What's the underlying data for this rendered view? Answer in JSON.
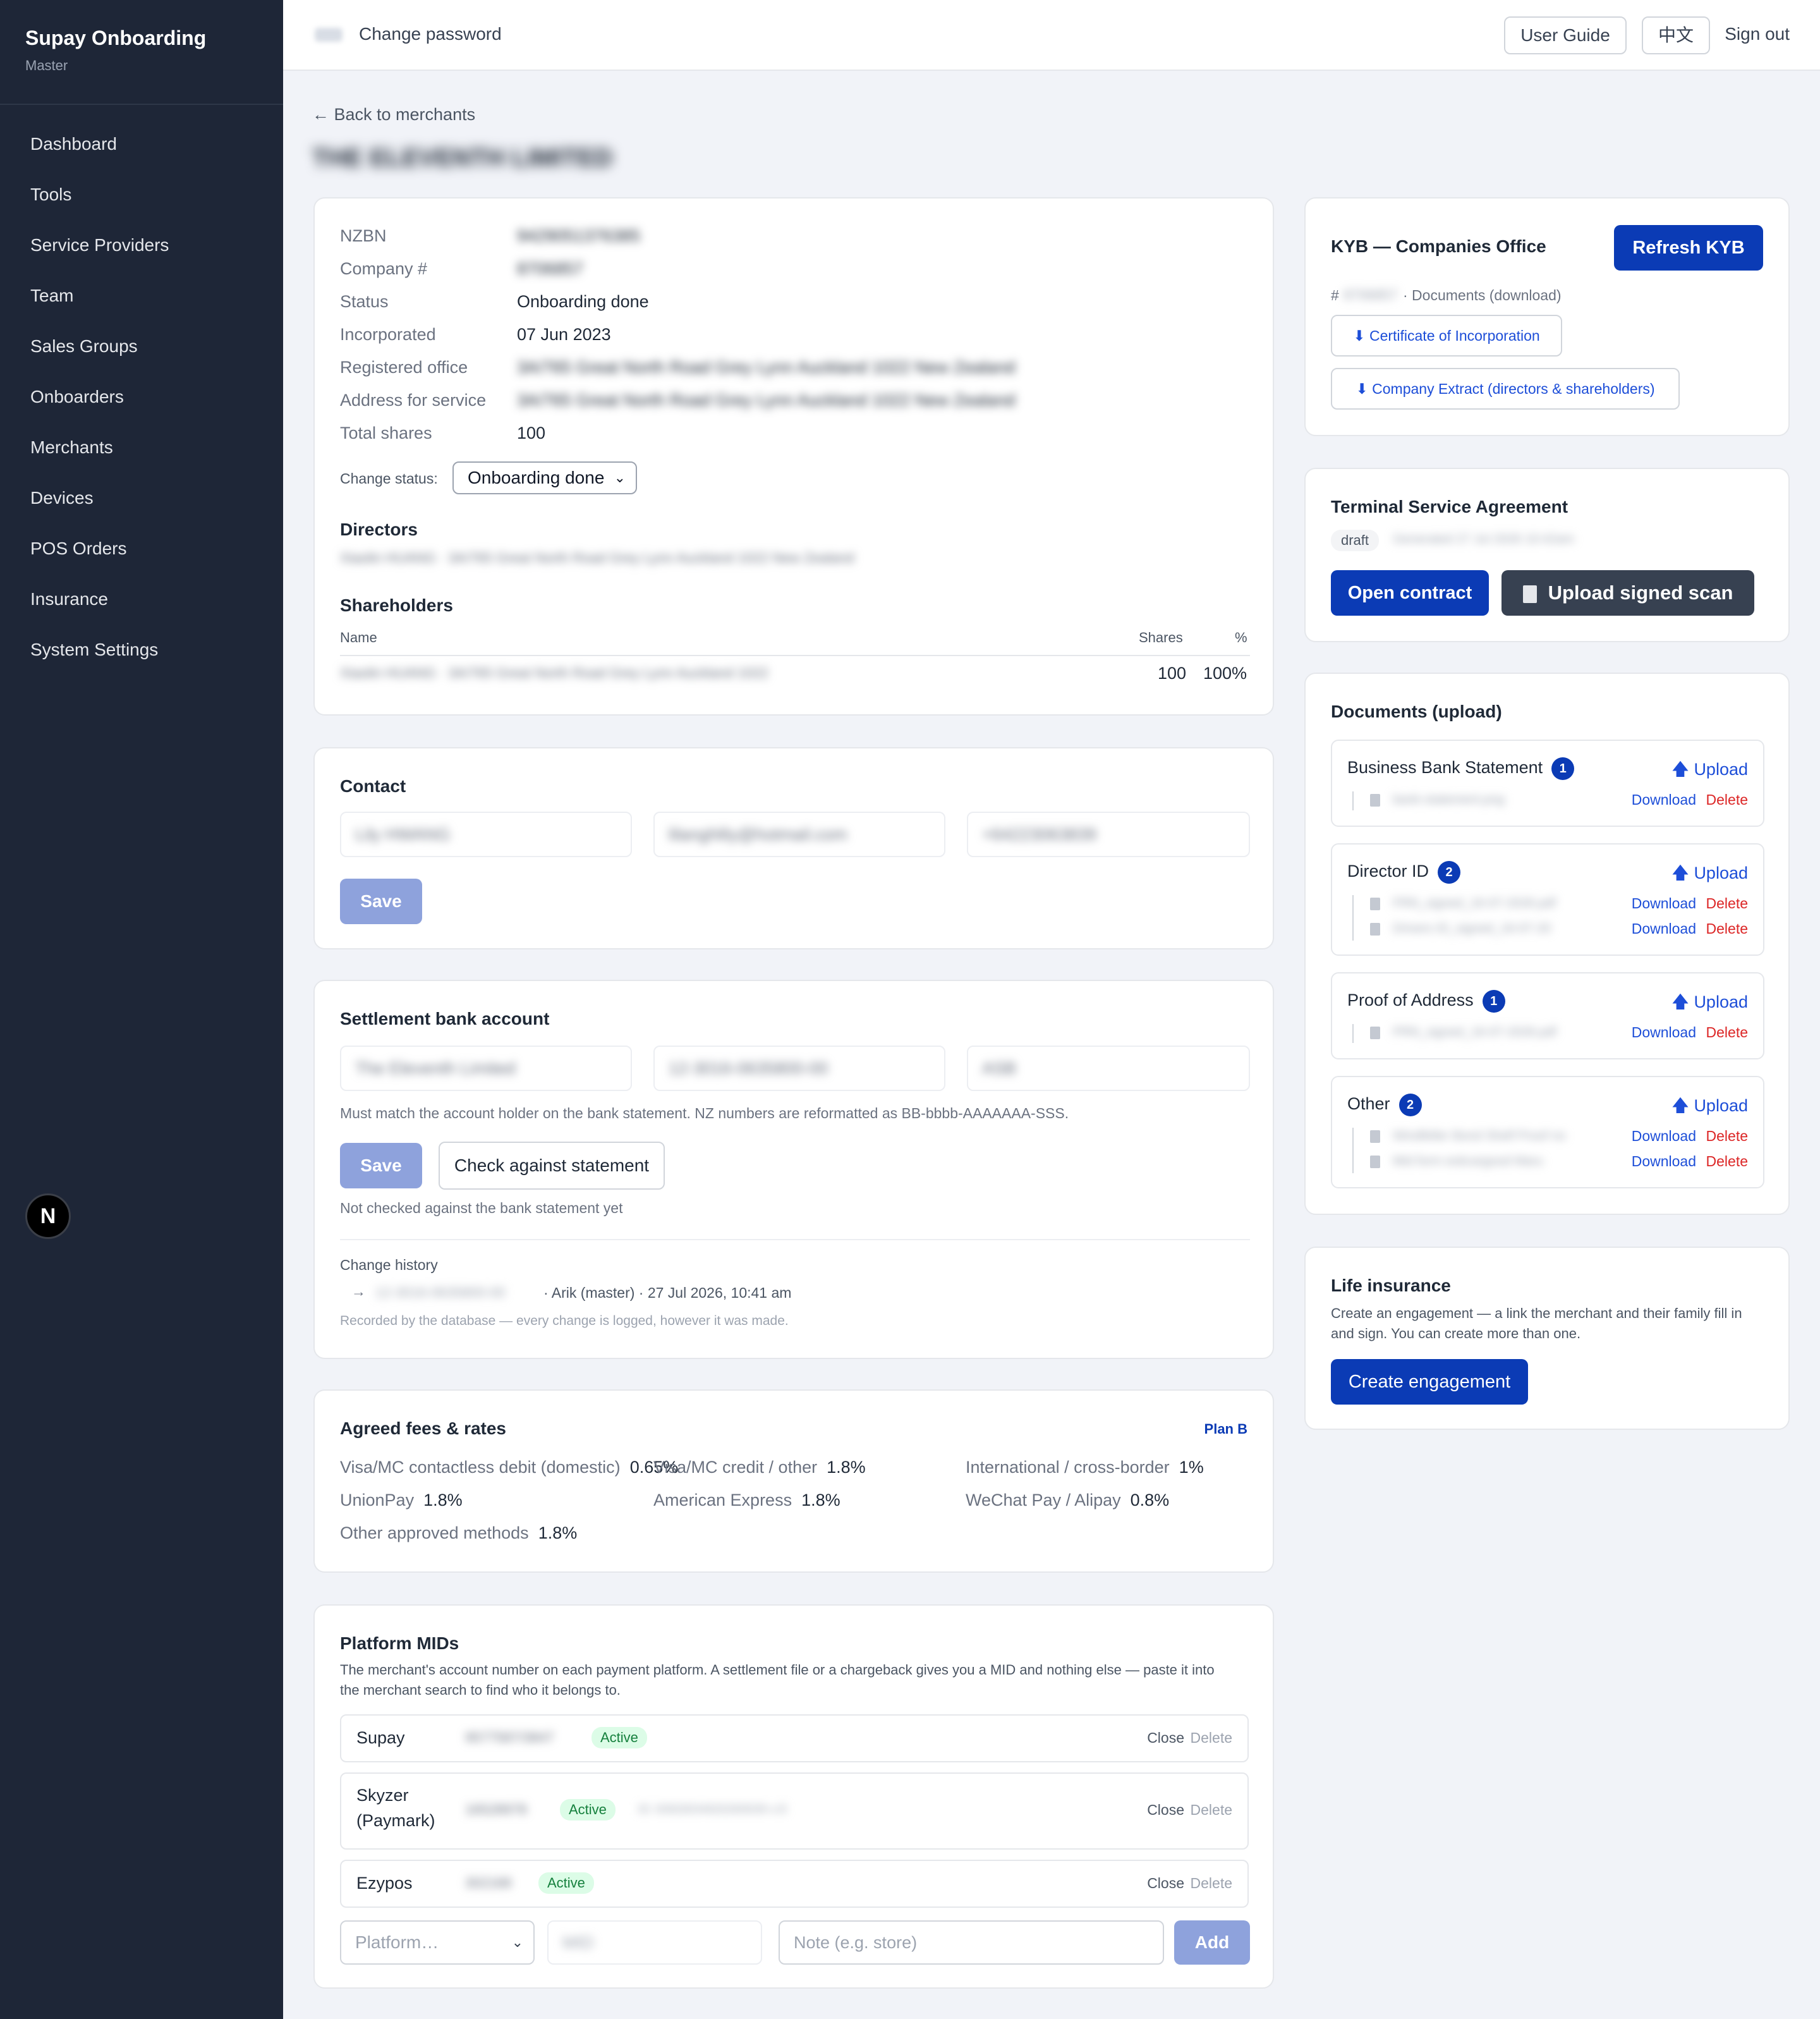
{
  "sidebar": {
    "brand_title": "Supay Onboarding",
    "brand_sub": "Master",
    "items": [
      "Dashboard",
      "Tools",
      "Service Providers",
      "Team",
      "Sales Groups",
      "Onboarders",
      "Merchants",
      "Devices",
      "POS Orders",
      "Insurance",
      "System Settings"
    ],
    "badge": "N"
  },
  "topbar": {
    "change_password": "Change password",
    "user_guide": "User Guide",
    "lang": "中文",
    "sign_out": "Sign out"
  },
  "page": {
    "back": "← Back to merchants",
    "merchant_name": "THE ELEVENTH LIMITED"
  },
  "company": {
    "rows": [
      {
        "label": "NZBN",
        "value": "9429051376385"
      },
      {
        "label": "Company #",
        "value": "8706857"
      },
      {
        "label": "Status",
        "value": "Onboarding done"
      },
      {
        "label": "Incorporated",
        "value": "07 Jun 2023"
      },
      {
        "label": "Registered office",
        "value": "3A/765 Great North Road Grey Lynn Auckland 1022 New Zealand"
      },
      {
        "label": "Address for service",
        "value": "3A/765 Great North Road Grey Lynn Auckland 1022 New Zealand"
      },
      {
        "label": "Total shares",
        "value": "100"
      }
    ],
    "change_status_label": "Change status:",
    "change_status_value": "Onboarding done",
    "directors_title": "Directors",
    "director_line": "Xiaolin HUANG · 3A/765 Great North Road Grey Lynn Auckland 1022 New Zealand",
    "shareholders_title": "Shareholders",
    "sh_col_name": "Name",
    "sh_col_shares": "Shares",
    "sh_col_pct": "%",
    "sh_name": "Xiaolin HUANG · 3A/765 Great North Road Grey Lynn Auckland 1022",
    "sh_shares": "100",
    "sh_pct": "100%"
  },
  "contact": {
    "title": "Contact",
    "name": "Lily HWANG",
    "email": "lilanghlily@hotmail.com",
    "phone": "+64223063839",
    "save": "Save"
  },
  "settlement": {
    "title": "Settlement bank account",
    "holder": "The Eleventh Limited",
    "account": "12-3016-0635800-00",
    "bank": "ASB",
    "hint": "Must match the account holder on the bank statement. NZ numbers are reformatted as BB-bbbb-AAAAAAA-SSS.",
    "save": "Save",
    "check": "Check against statement",
    "not_checked": "Not checked against the bank statement yet",
    "history_title": "Change history",
    "history_arrow": "→",
    "history_value": "12-3016-0635800-00",
    "history_meta": "· Arik (master) · 27 Jul 2026, 10:41 am",
    "history_note": "Recorded by the database — every change is logged, however it was made."
  },
  "fees": {
    "title": "Agreed fees & rates",
    "plan": "Plan B",
    "items": [
      {
        "label": "Visa/MC contactless debit (domestic)",
        "value": "0.65%"
      },
      {
        "label": "Visa/MC credit / other",
        "value": "1.8%"
      },
      {
        "label": "International / cross-border",
        "value": "1%"
      },
      {
        "label": "UnionPay",
        "value": "1.8%"
      },
      {
        "label": "American Express",
        "value": "1.8%"
      },
      {
        "label": "WeChat Pay / Alipay",
        "value": "0.8%"
      },
      {
        "label": "Other approved methods",
        "value": "1.8%"
      }
    ]
  },
  "mids": {
    "title": "Platform MIDs",
    "desc": "The merchant's account number on each payment platform. A settlement file or a chargeback gives you a MID and nothing else — paste it into the merchant search to find who it belongs to.",
    "rows": [
      {
        "platform": "Supay",
        "mid": "9577587/3847",
        "status": "Active",
        "note": ""
      },
      {
        "platform": "Skyzer (Paymark)",
        "mid": "16528978",
        "status": "Active",
        "note": "ID: 8392003492029/0039 v.l3"
      },
      {
        "platform": "Ezypos",
        "mid": "302168",
        "status": "Active",
        "note": ""
      }
    ],
    "close": "Close",
    "delete": "Delete",
    "platform_placeholder": "Platform…",
    "mid_placeholder": "MID",
    "note_placeholder": "Note (e.g. store)",
    "add": "Add"
  },
  "kyb": {
    "title": "KYB — Companies Office",
    "refresh": "Refresh KYB",
    "hash": "#",
    "company_no": "8706857",
    "docs_label": "· Documents (download)",
    "cert": "⬇ Certificate of Incorporation",
    "extract": "⬇ Company Extract (directors & shareholders)"
  },
  "tsa": {
    "title": "Terminal Service Agreement",
    "status": "draft",
    "status_detail": "Generated 27 Jul 2026 10:42am",
    "open": "Open contract",
    "upload": "Upload signed scan"
  },
  "docs": {
    "title": "Documents (upload)",
    "upload": "Upload",
    "download": "Download",
    "delete": "Delete",
    "groups": [
      {
        "name": "Business Bank Statement",
        "count": "1",
        "files": [
          "bank-statement.png"
        ]
      },
      {
        "name": "Director ID",
        "count": "2",
        "files": [
          "FRN_signed_16-07-2026.pdf",
          "Drivers ID_signed_16-07-20"
        ]
      },
      {
        "name": "Proof of Address",
        "count": "1",
        "files": [
          "PRN_signed_16-07-2026.pdf"
        ]
      },
      {
        "name": "Other",
        "count": "2",
        "files": [
          "Windfeller Bond Shelf Proof no",
          "Mid form esticargood Maru"
        ]
      }
    ]
  },
  "insurance": {
    "title": "Life insurance",
    "desc": "Create an engagement — a link the merchant and their family fill in and sign. You can create more than one.",
    "create": "Create engagement"
  },
  "colors": {
    "sidebar_bg": "#1e2637",
    "primary": "#0b3bb5",
    "primary_light": "#8ea2dc",
    "danger": "#dc2626",
    "success": "#15803d"
  }
}
